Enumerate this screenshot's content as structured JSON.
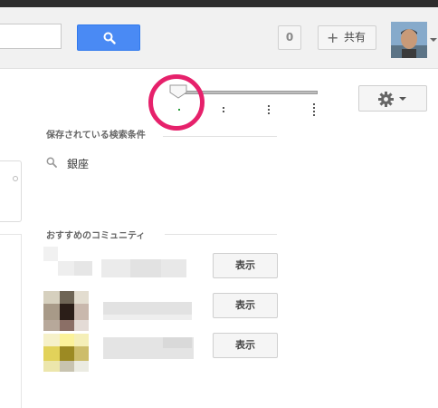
{
  "header": {
    "search_placeholder": "",
    "notification_count": "0",
    "share_label": "共有"
  },
  "toolbar": {
    "slider_value": 0,
    "slider_steps": 5
  },
  "saved_searches": {
    "title": "保存されている検索条件",
    "items": [
      {
        "label": "銀座"
      }
    ]
  },
  "recommended": {
    "title": "おすすめのコミュニティ",
    "communities": [
      {
        "button_label": "表示"
      },
      {
        "button_label": "表示"
      },
      {
        "button_label": "表示"
      }
    ]
  },
  "colors": {
    "search_button": "#4a8af4",
    "highlight_ring": "#e6216b",
    "header_bg": "#f1f1f1"
  },
  "icons": [
    "search-icon",
    "plus-icon",
    "gear-icon",
    "chevron-down-icon",
    "magnifier-icon"
  ]
}
